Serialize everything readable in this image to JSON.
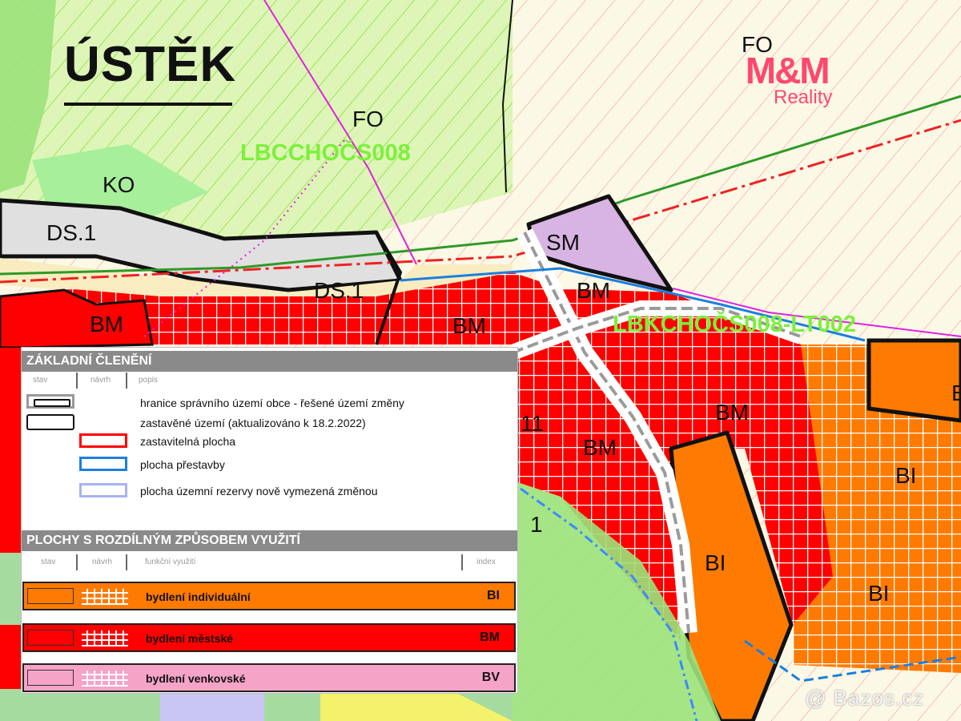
{
  "map": {
    "title": "ÚSTĚK",
    "zone_labels": [
      "FO",
      "FO",
      "KO",
      "DS.1",
      "DS.1",
      "SM",
      "BM",
      "BM",
      "BM",
      "BM",
      "BM",
      "BI",
      "BI",
      "BI",
      "BI",
      "11",
      "1"
    ],
    "corridor_labels": [
      "LBCCHOČS008",
      "LBKCHOČS008-LT002"
    ],
    "colors": {
      "background": "#fbf8e6",
      "bydleni_individualni": "#ff7a00",
      "bydleni_mestske": "#ff0000",
      "bydleni_venkovske": "#f5a3c7",
      "smisene": "#d8b4e2",
      "dopravni": "#d8d8d8",
      "zelen": "#9be27a",
      "corridor_label": "#7cf03a"
    }
  },
  "watermarks": {
    "brand": "M&M",
    "brand_sub": "Reality",
    "site": "@ Bazos.cz"
  },
  "legend": {
    "section1": {
      "heading": "ZÁKLADNÍ ČLENĚNÍ",
      "col_stav": "stav",
      "col_navrh": "návrh",
      "col_popis": "popis",
      "items": [
        {
          "label": "hranice správního území obce - řešené území změny",
          "symbol": "admin-boundary-icon"
        },
        {
          "label": "zastavěné území (aktualizováno k 18.2.2022)",
          "symbol": "built-up-area-icon"
        },
        {
          "label": "zastavitelná plocha",
          "symbol": "buildable-area-icon",
          "color": "#ff0000"
        },
        {
          "label": "plocha přestavby",
          "symbol": "redevelopment-area-icon",
          "color": "#1a7fe0"
        },
        {
          "label": "plocha územní rezervy nově vymezená změnou",
          "symbol": "reserve-area-icon",
          "color": "#a8b4f0"
        }
      ]
    },
    "section2": {
      "heading": "PLOCHY S ROZDÍLNÝM ZPŮSOBEM VYUŽITÍ",
      "col_stav": "stav",
      "col_navrh": "návrh",
      "col_funkce": "funkční využití",
      "col_index": "index",
      "items": [
        {
          "label": "bydlení individuální",
          "index": "BI",
          "color": "#ff7a00"
        },
        {
          "label": "bydlení městské",
          "index": "BM",
          "color": "#ff0000"
        },
        {
          "label": "bydlení venkovské",
          "index": "BV",
          "color": "#f5a3c7"
        }
      ]
    }
  }
}
